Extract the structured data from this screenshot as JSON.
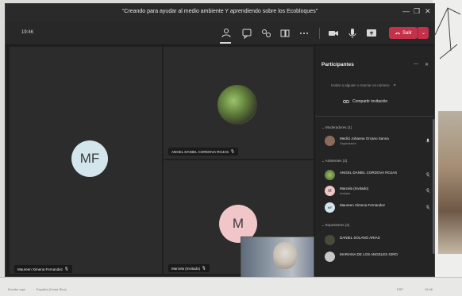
{
  "window": {
    "title": "“Creando para ayudar al medio ambiente Y aprendiendo sobre los Ecobloques”",
    "minimize": "—",
    "maximize": "❐",
    "close": "✕"
  },
  "toolbar": {
    "timer": "19:46",
    "leave_label": "Salir",
    "leave_dropdown": "⌄"
  },
  "tiles": [
    {
      "initials": "MF",
      "name": "Maureen Ximena Fernandez",
      "avatar_color": "#d2e6ec"
    },
    {
      "initials": "",
      "name": "ANGEL DANIEL CORDOVA ROJAS"
    },
    {
      "initials": "M",
      "name": "Marcela (Invitado)",
      "avatar_color": "#f0c6c8"
    }
  ],
  "panel": {
    "title": "Participantes",
    "minimize": "—",
    "close": "✕",
    "invite_text": "Invitar a alguien o marcar un número",
    "share_label": "Compartir invitación",
    "sections": [
      {
        "heading": "Moderadores (1)",
        "people": [
          {
            "name": "Medici Johanna Orcano Sanna",
            "role": "Organizador",
            "initials": "",
            "color": "#8a6b5a"
          }
        ]
      },
      {
        "heading": "Asistentes (3)",
        "people": [
          {
            "name": "ANGEL DANIEL CORDOVA ROJAS",
            "role": "",
            "initials": "",
            "color": "#6c8a44"
          },
          {
            "name": "Marcela (Invitado)",
            "role": "Invitado",
            "initials": "M",
            "color": "#f0c6c8"
          },
          {
            "name": "Maureen Ximena Fernandez",
            "role": "",
            "initials": "MF",
            "color": "#d2e6ec"
          }
        ]
      },
      {
        "heading": "Expositores (2)",
        "people": [
          {
            "name": "DANIEL SOLANO ARIAS",
            "role": "",
            "initials": "",
            "color": "#4a4a3a"
          },
          {
            "name": "MARIANA DE LOS ANGELES GIRO",
            "role": "",
            "initials": "",
            "color": "#c8c8c8"
          }
        ]
      }
    ]
  },
  "taskbar": {
    "left_items": [
      "Escribe aquí",
      "Español (Costa Rica)"
    ],
    "right_items": [
      "ESP",
      "19:46"
    ]
  },
  "colors": {
    "accent": "#c4314b",
    "window_bg": "#201f1f",
    "tile_bg": "#2d2c2c",
    "panel_bg": "#252424"
  }
}
